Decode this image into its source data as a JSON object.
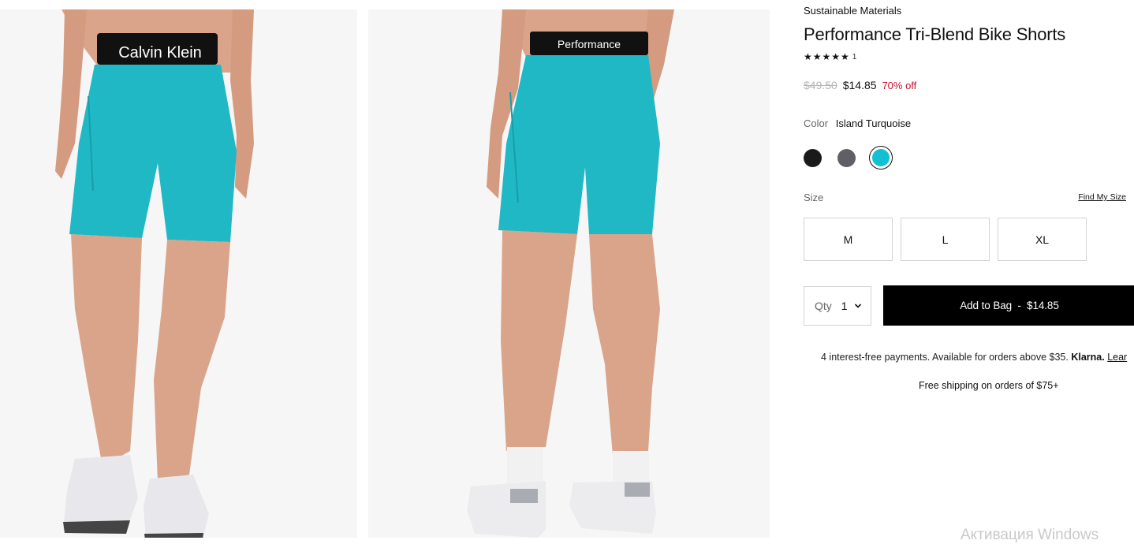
{
  "images": [
    {
      "brand_text": "Calvin Klein",
      "alt": "front view"
    },
    {
      "brand_text": "Performance",
      "alt": "back view"
    }
  ],
  "product": {
    "tag": "Sustainable Materials",
    "title": "Performance Tri-Blend Bike Shorts",
    "rating_stars": "★★★★★",
    "rating_count": "1",
    "price_original": "$49.50",
    "price_sale": "$14.85",
    "discount": "70% off"
  },
  "color": {
    "label": "Color",
    "selected": "Island Turquoise",
    "swatches": [
      {
        "name": "black",
        "hex": "#1a1a1a"
      },
      {
        "name": "grey",
        "hex": "#5f5f66"
      },
      {
        "name": "island-turquoise",
        "hex": "#12c0d4",
        "selected": true
      }
    ]
  },
  "size": {
    "label": "Size",
    "find_my_size": "Find My Size",
    "options": [
      "M",
      "L",
      "XL"
    ]
  },
  "purchase": {
    "qty_label": "Qty",
    "qty_value": "1",
    "add_to_bag": "Add to Bag  -  $14.85"
  },
  "klarna": {
    "text": "4 interest-free payments. Available for orders above $35.",
    "brand": "Klarna.",
    "link": "Lear"
  },
  "shipping": "Free shipping on orders of $75+",
  "watermark": "Активация Windows"
}
